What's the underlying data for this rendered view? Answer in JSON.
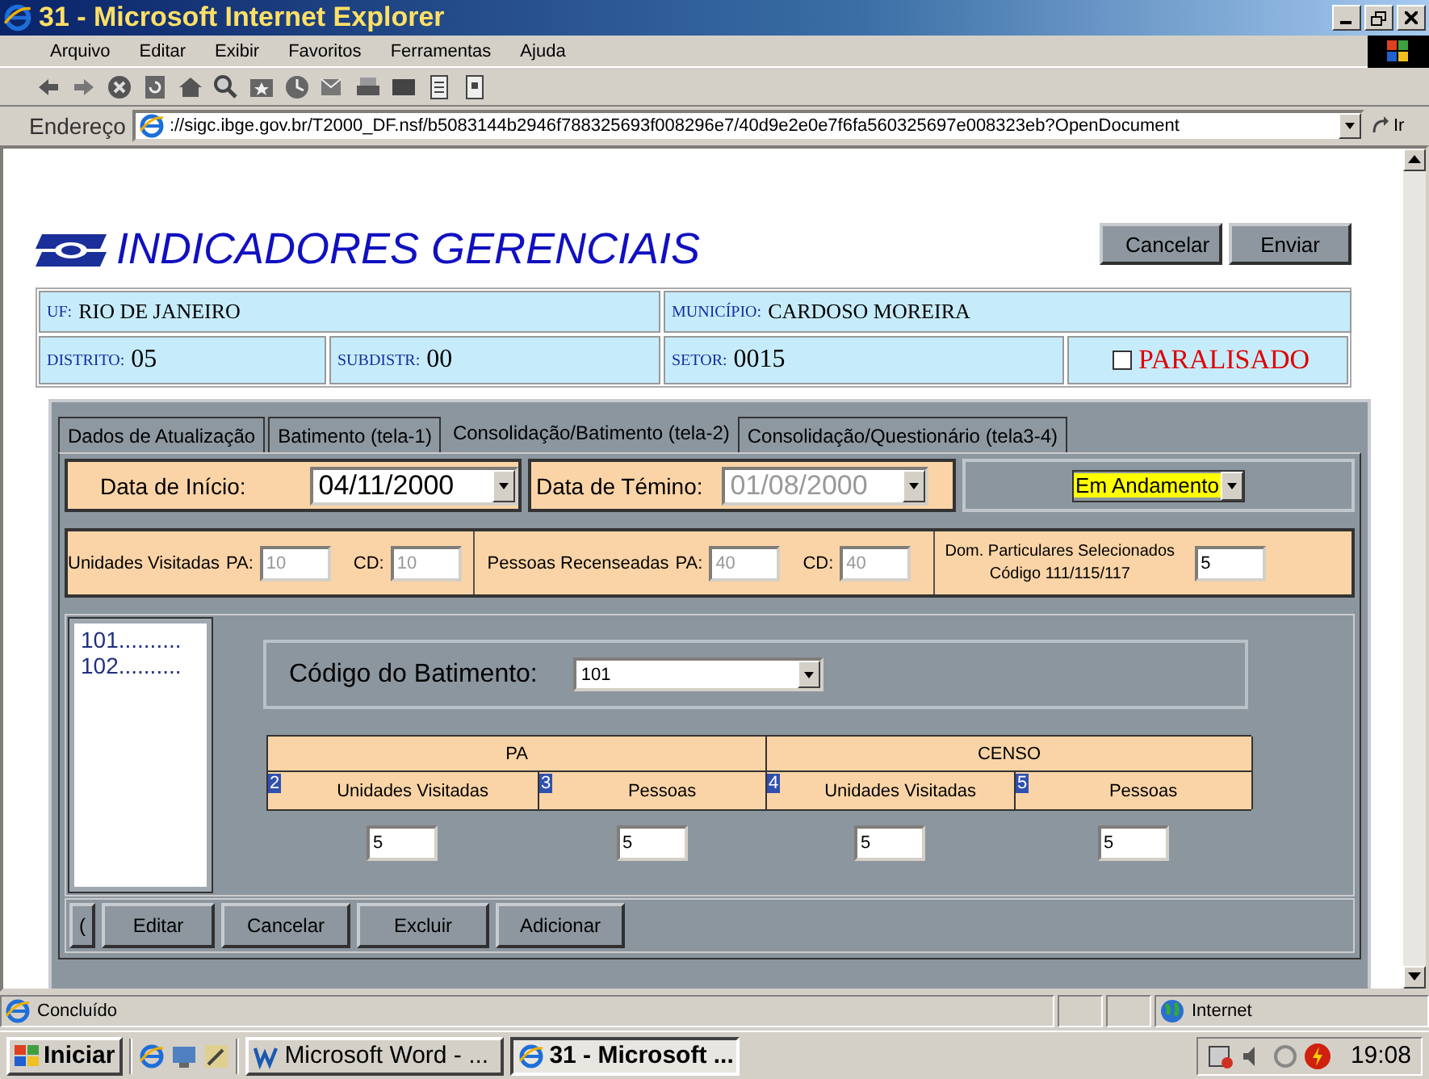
{
  "window": {
    "title": "31 - Microsoft Internet Explorer"
  },
  "menu": [
    "Arquivo",
    "Editar",
    "Exibir",
    "Favoritos",
    "Ferramentas",
    "Ajuda"
  ],
  "address": {
    "label": "Endereço",
    "url": "://sigc.ibge.gov.br/T2000_DF.nsf/b5083144b2946f788325693f008296e7/40d9e2e0e7f6fa560325697e008323eb?OpenDocument",
    "go": "Ir"
  },
  "header": {
    "title": "INDICADORES GERENCIAIS",
    "buttons": [
      "Cancelar",
      "Enviar"
    ]
  },
  "location": {
    "state": {
      "label": "UF:",
      "value": "RIO DE JANEIRO"
    },
    "municipality": {
      "label": "MUNICÍPIO:",
      "value": "CARDOSO MOREIRA"
    }
  },
  "area": [
    {
      "kind": "field",
      "label": "DISTRITO:",
      "value": "05"
    },
    {
      "kind": "field",
      "label": "SUBDISTR:",
      "value": "00"
    },
    {
      "kind": "field",
      "label": "SETOR:",
      "value": "0015"
    },
    {
      "kind": "checkbox",
      "label": "PARALISADO",
      "checked": false
    }
  ],
  "tabs": [
    {
      "label": "Dados de Atualização",
      "selected": false
    },
    {
      "label": "Batimento (tela-1)",
      "selected": false
    },
    {
      "label": "Consolidação/Batimento (tela-2)",
      "selected": true
    },
    {
      "label": "Consolidação/Questionário (tela3-4)",
      "selected": false
    }
  ],
  "dates": [
    {
      "label": "Data de Início:",
      "value": "04/11/2000",
      "disabled": false
    },
    {
      "label": "Data de Témino:",
      "value": "01/08/2000",
      "disabled": true
    }
  ],
  "situation": {
    "value": "Em Andamento",
    "focused": true
  },
  "counts": [
    {
      "label": "Unidades Visitadas",
      "pa_label": "PA:",
      "pa": "10",
      "cd_label": "CD:",
      "cd": "10",
      "disabled": true
    },
    {
      "label": "Pessoas Recenseadas",
      "pa_label": "PA:",
      "pa": "40",
      "cd_label": "CD:",
      "cd": "40",
      "disabled": true
    }
  ],
  "selected_households": {
    "lines": [
      "Dom. Particulares Selecionados",
      "Código 111/115/117"
    ],
    "value": "5"
  },
  "codes": [
    "101..........",
    "102.........."
  ],
  "batimento": {
    "label": "Código do Batimento:",
    "value": "101"
  },
  "table": {
    "groups": [
      "PA",
      "CENSO"
    ],
    "columns": [
      {
        "num": "2",
        "label": "Unidades Visitadas",
        "value": "5"
      },
      {
        "num": "3",
        "label": "Pessoas",
        "value": "5"
      },
      {
        "num": "4",
        "label": "Unidades Visitadas",
        "value": "5"
      },
      {
        "num": "5",
        "label": "Pessoas",
        "value": "5"
      }
    ]
  },
  "actions": [
    "(",
    "Editar",
    "Cancelar",
    "Excluir",
    "Adicionar"
  ],
  "status_bar": {
    "text": "Concluído",
    "zone": "Internet"
  },
  "taskbar": {
    "start": "Iniciar",
    "tasks": [
      {
        "label": "Microsoft Word - ...",
        "kind": "word",
        "selected": false
      },
      {
        "label": "31 - Microsoft ...",
        "kind": "browser",
        "selected": true
      }
    ],
    "clock": "19:08"
  }
}
